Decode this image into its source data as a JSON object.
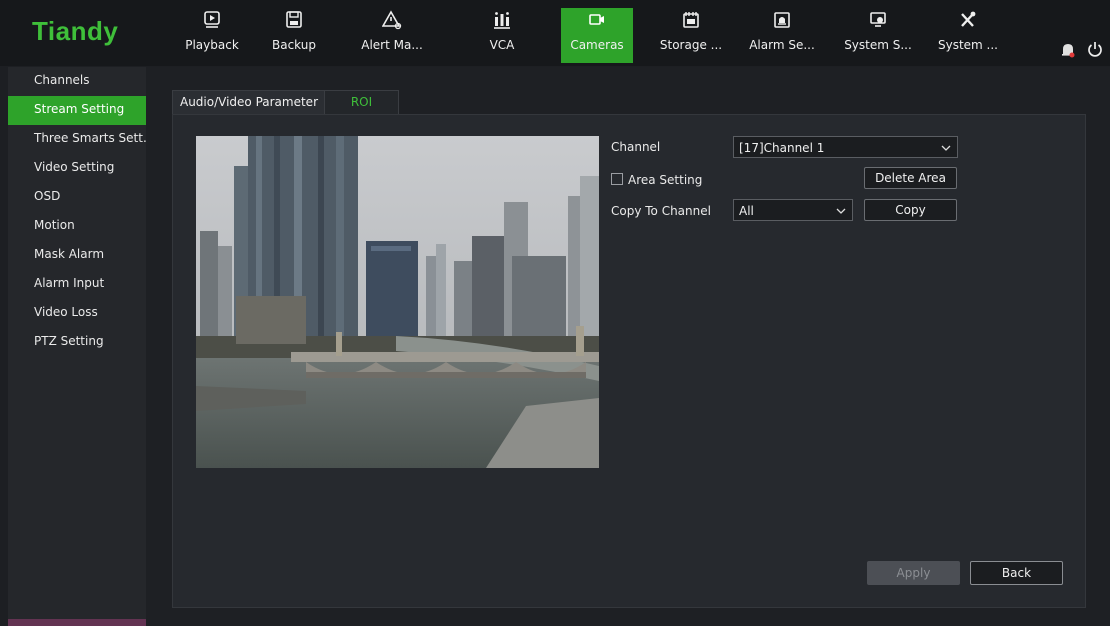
{
  "app": {
    "logo": "Tiandy"
  },
  "nav": [
    {
      "label": "Playback",
      "icon": "playback-icon"
    },
    {
      "label": "Backup",
      "icon": "save-icon"
    },
    {
      "label": "Alert Ma...",
      "icon": "alert-icon"
    },
    {
      "label": "VCA",
      "icon": "vca-icon"
    },
    {
      "label": "Cameras",
      "icon": "camera-icon",
      "active": true
    },
    {
      "label": "Storage ...",
      "icon": "storage-icon"
    },
    {
      "label": "Alarm Se...",
      "icon": "alarm-icon"
    },
    {
      "label": "System S...",
      "icon": "system-settings-icon"
    },
    {
      "label": "System ...",
      "icon": "tools-icon"
    }
  ],
  "sidebar": {
    "items": [
      {
        "label": "Channels"
      },
      {
        "label": "Stream Setting",
        "active": true
      },
      {
        "label": "Three Smarts Sett..."
      },
      {
        "label": "Video Setting"
      },
      {
        "label": "OSD"
      },
      {
        "label": "Motion"
      },
      {
        "label": "Mask Alarm"
      },
      {
        "label": "Alarm Input"
      },
      {
        "label": "Video Loss"
      },
      {
        "label": "PTZ Setting"
      }
    ]
  },
  "tabs": [
    {
      "label": "Audio/Video Parameter"
    },
    {
      "label": "ROI",
      "active": true
    }
  ],
  "form": {
    "channel_label": "Channel",
    "channel_value": "[17]Channel 1",
    "area_setting_label": "Area Setting",
    "area_setting_checked": false,
    "delete_area_label": "Delete Area",
    "copy_to_channel_label": "Copy To Channel",
    "copy_to_channel_value": "All",
    "copy_label": "Copy"
  },
  "footer": {
    "apply_label": "Apply",
    "back_label": "Back"
  },
  "colors": {
    "accent": "#2ea32a",
    "logo": "#3fbf3a",
    "bell_badge": "#e03a3a"
  }
}
